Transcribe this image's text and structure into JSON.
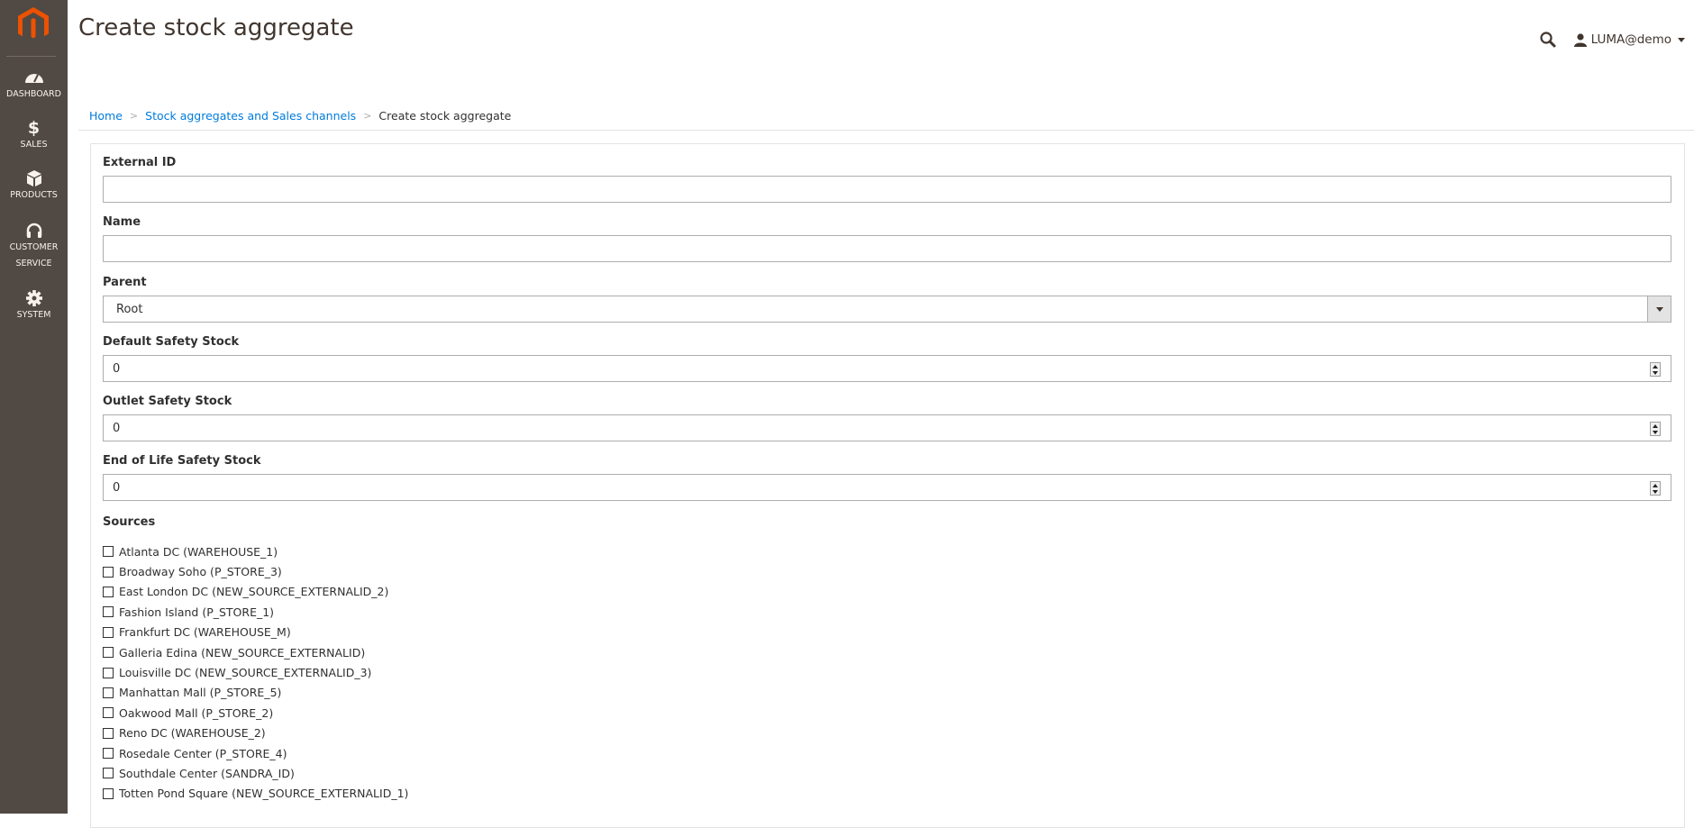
{
  "sidebar": {
    "logo": "magento-logo",
    "items": [
      {
        "label": "DASHBOARD",
        "icon": "dashboard-icon"
      },
      {
        "label": "SALES",
        "icon": "dollar-icon"
      },
      {
        "label": "PRODUCTS",
        "icon": "box-icon"
      },
      {
        "label": "CUSTOMER",
        "label2": "SERVICE",
        "icon": "headset-icon"
      },
      {
        "label": "SYSTEM",
        "icon": "gear-icon"
      }
    ]
  },
  "header": {
    "title": "Create stock aggregate",
    "user": "LUMA@demo"
  },
  "breadcrumb": {
    "items": [
      "Home",
      "Stock aggregates and Sales channels"
    ],
    "separator": ">",
    "current": "Create stock aggregate"
  },
  "form": {
    "external_id": {
      "label": "External ID",
      "value": ""
    },
    "name": {
      "label": "Name",
      "value": ""
    },
    "parent": {
      "label": "Parent",
      "value": "Root"
    },
    "default_safety_stock": {
      "label": "Default Safety Stock",
      "value": "0"
    },
    "outlet_safety_stock": {
      "label": "Outlet Safety Stock",
      "value": "0"
    },
    "eol_safety_stock": {
      "label": "End of Life Safety Stock",
      "value": "0"
    },
    "sources": {
      "label": "Sources",
      "items": [
        {
          "label": "Atlanta DC (WAREHOUSE_1)",
          "checked": false
        },
        {
          "label": "Broadway Soho (P_STORE_3)",
          "checked": false
        },
        {
          "label": "East London DC (NEW_SOURCE_EXTERNALID_2)",
          "checked": false
        },
        {
          "label": "Fashion Island (P_STORE_1)",
          "checked": false
        },
        {
          "label": "Frankfurt DC (WAREHOUSE_M)",
          "checked": false
        },
        {
          "label": "Galleria Edina (NEW_SOURCE_EXTERNALID)",
          "checked": false
        },
        {
          "label": "Louisville DC (NEW_SOURCE_EXTERNALID_3)",
          "checked": false
        },
        {
          "label": "Manhattan Mall (P_STORE_5)",
          "checked": false
        },
        {
          "label": "Oakwood Mall (P_STORE_2)",
          "checked": false
        },
        {
          "label": "Reno DC (WAREHOUSE_2)",
          "checked": false
        },
        {
          "label": "Rosedale Center (P_STORE_4)",
          "checked": false
        },
        {
          "label": "Southdale Center (SANDRA_ID)",
          "checked": false
        },
        {
          "label": "Totten Pond Square (NEW_SOURCE_EXTERNALID_1)",
          "checked": false
        }
      ]
    }
  },
  "colors": {
    "sidebar_bg": "#514943",
    "logo": "#eb5202",
    "link": "#007bdb"
  }
}
